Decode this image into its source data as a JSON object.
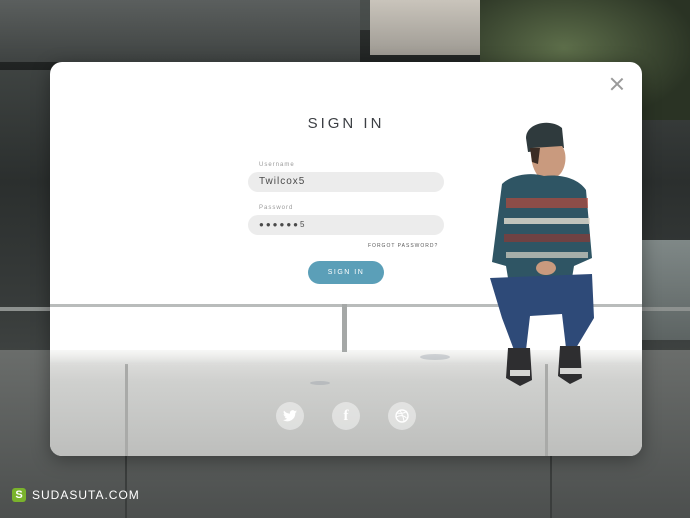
{
  "dialog": {
    "title": "SIGN IN",
    "username": {
      "label": "Username",
      "value": "Twilcox5"
    },
    "password": {
      "label": "Password",
      "value": "●●●●●●5"
    },
    "forgot_link": "FORGOT PASSWORD?",
    "signin_button": "SIGN IN"
  },
  "social": [
    "twitter-icon",
    "facebook-icon",
    "dribbble-icon"
  ],
  "watermark": {
    "logo_letter": "S",
    "site": "SUDASUTA.COM"
  },
  "colors": {
    "accent": "#5b9fb8",
    "field_bg": "#ececec",
    "title": "#3c3f44"
  }
}
